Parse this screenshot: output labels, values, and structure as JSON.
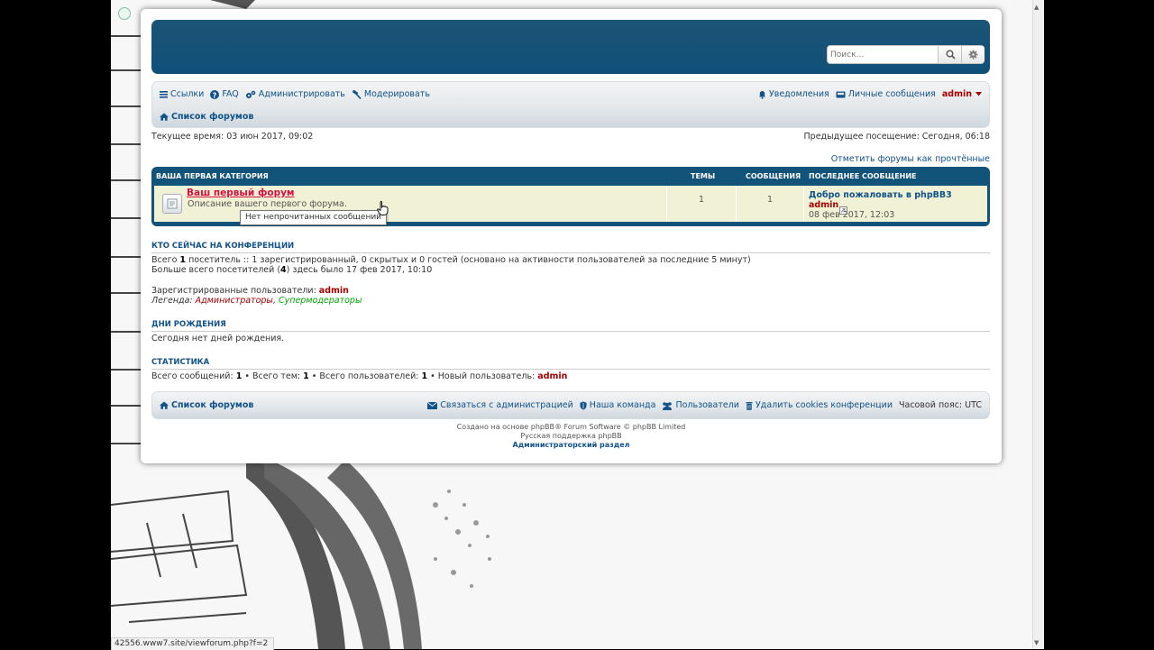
{
  "browser": {
    "status_url": "42556.www7.site/viewforum.php?f=2"
  },
  "header": {
    "search_placeholder": "Поиск…",
    "search_icon": "search-icon",
    "advanced_search_icon": "gear-icon"
  },
  "navbar": {
    "links": [
      {
        "label": "Ссылки",
        "icon": "hamburger-icon"
      },
      {
        "label": "FAQ",
        "icon": "question-icon"
      },
      {
        "label": "Администрировать",
        "icon": "gears-icon"
      },
      {
        "label": "Модерировать",
        "icon": "gavel-icon"
      }
    ],
    "notifications": "Уведомления",
    "messages": "Личные сообщения",
    "username": "admin",
    "breadcrumb": "Список форумов"
  },
  "info": {
    "current_time": "Текущее время: 03 июн 2017, 09:02",
    "last_visit": "Предыдущее посещение: Сегодня, 06:18",
    "mark_read": "Отметить форумы как прочтённые"
  },
  "forum_table": {
    "category": "Ваша первая категория",
    "col_topics": "Темы",
    "col_posts": "Сообщения",
    "col_last": "Последнее сообщение",
    "forum": {
      "title": "Ваш первый форум",
      "description": "Описание вашего первого форума.",
      "topics": "1",
      "posts": "1",
      "last_title": "Добро пожаловать в phpBB3",
      "last_author": "admin",
      "last_date": "08 фев 2017, 12:03"
    },
    "tooltip": "Нет непрочитанных сообщений"
  },
  "online": {
    "heading": "Кто сейчас на конференции",
    "line1_a": "Всего ",
    "line1_b": "1",
    "line1_c": " посетитель :: 1 зарегистрированный, 0 скрытых и 0 гостей (основано на активности пользователей за последние 5 минут)",
    "line2_a": "Больше всего посетителей (",
    "line2_b": "4",
    "line2_c": ") здесь было 17 фев 2017, 10:10",
    "registered_label": "Зарегистрированные пользователи: ",
    "registered_user": "admin",
    "legend_label": "Легенда: ",
    "legend_admins": "Администраторы",
    "legend_sep": ", ",
    "legend_smods": "Супермодераторы"
  },
  "birthdays": {
    "heading": "Дни рождения",
    "text": "Сегодня нет дней рождения."
  },
  "stats": {
    "heading": "Статистика",
    "posts_label": "Всего сообщений: ",
    "posts": "1",
    "topics_label": " • Всего тем: ",
    "topics": "1",
    "users_label": " • Всего пользователей: ",
    "users": "1",
    "newest_label": " • Новый пользователь: ",
    "newest": "admin"
  },
  "footer": {
    "index": "Список форумов",
    "contact": "Связаться с администрацией",
    "team": "Наша команда",
    "members": "Пользователи",
    "delete_cookies": "Удалить cookies конференции",
    "timezone": "Часовой пояс: UTC",
    "powered": "Создано на основе phpBB® Forum Software © phpBB Limited",
    "support": "Русская поддержка phpBB",
    "acp": "Администраторский раздел"
  }
}
